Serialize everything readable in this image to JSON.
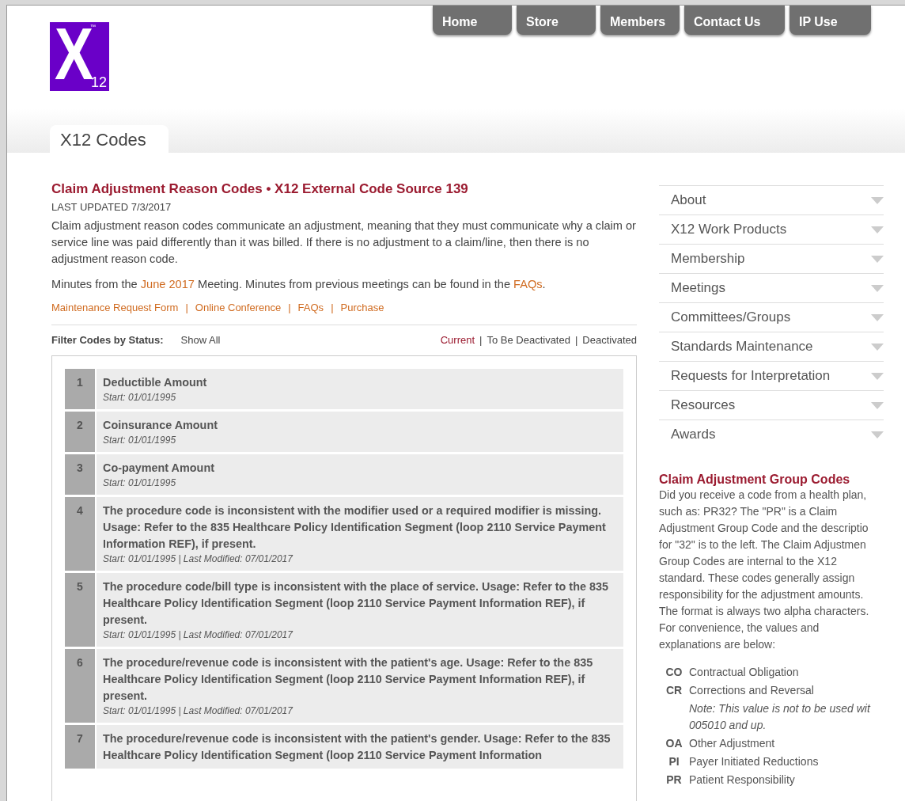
{
  "logo": {
    "mark": "X",
    "number": "12",
    "trademark": "™"
  },
  "nav": [
    {
      "label": "Home"
    },
    {
      "label": "Store"
    },
    {
      "label": "Members"
    },
    {
      "label": "Contact Us"
    },
    {
      "label": "IP Use"
    }
  ],
  "section_tab": "X12 Codes",
  "title": "Claim Adjustment Reason Codes • X12 External Code Source 139",
  "last_updated": "LAST UPDATED 7/3/2017",
  "intro": "Claim adjustment reason codes communicate an adjustment, meaning that they must communicate why a claim or service line was paid differently than it was billed. If there is no adjustment to a claim/line, then there is no adjustment reason code.",
  "minutes": [
    {
      "kind": "text",
      "text": "Minutes from the "
    },
    {
      "kind": "link",
      "text": "June 2017"
    },
    {
      "kind": "text",
      "text": " Meeting. Minutes from previous meetings can be found in the "
    },
    {
      "kind": "link",
      "text": "FAQs"
    },
    {
      "kind": "text",
      "text": "."
    }
  ],
  "links_separator": "|",
  "links": [
    {
      "label": "Maintenance Request Form"
    },
    {
      "label": "Online Conference"
    },
    {
      "label": "FAQs"
    },
    {
      "label": "Purchase"
    }
  ],
  "filter": {
    "label": "Filter Codes by Status:",
    "show_all": "Show All",
    "separator": "|",
    "statuses": [
      {
        "label": "Current",
        "selected": true
      },
      {
        "label": "To Be Deactivated",
        "selected": false
      },
      {
        "label": "Deactivated",
        "selected": false
      }
    ]
  },
  "codes": [
    {
      "number": "1",
      "description": "Deductible Amount",
      "dates": "Start: 01/01/1995"
    },
    {
      "number": "2",
      "description": "Coinsurance Amount",
      "dates": "Start: 01/01/1995"
    },
    {
      "number": "3",
      "description": "Co-payment Amount",
      "dates": "Start: 01/01/1995"
    },
    {
      "number": "4",
      "description": "The procedure code is inconsistent with the modifier used or a required modifier is missing. Usage: Refer to the 835 Healthcare Policy Identification Segment (loop 2110 Service Payment Information REF), if present.",
      "dates": "Start: 01/01/1995 | Last Modified: 07/01/2017"
    },
    {
      "number": "5",
      "description": "The procedure code/bill type is inconsistent with the place of service. Usage: Refer to the 835 Healthcare Policy Identification Segment (loop 2110 Service Payment Information REF), if present.",
      "dates": "Start: 01/01/1995 | Last Modified: 07/01/2017"
    },
    {
      "number": "6",
      "description": "The procedure/revenue code is inconsistent with the patient's age. Usage: Refer to the 835 Healthcare Policy Identification Segment (loop 2110 Service Payment Information REF), if present.",
      "dates": "Start: 01/01/1995 | Last Modified: 07/01/2017"
    },
    {
      "number": "7",
      "description": "The procedure/revenue code is inconsistent with the patient's gender. Usage: Refer to the 835 Healthcare Policy Identification Segment (loop 2110 Service Payment Information"
    }
  ],
  "menu": [
    {
      "label": "About"
    },
    {
      "label": "X12 Work Products"
    },
    {
      "label": "Membership"
    },
    {
      "label": "Meetings"
    },
    {
      "label": "Committees/Groups"
    },
    {
      "label": "Standards Maintenance"
    },
    {
      "label": "Requests for Interpretation"
    },
    {
      "label": "Resources"
    },
    {
      "label": "Awards"
    }
  ],
  "group_codes": {
    "title": "Claim Adjustment Group Codes",
    "text": "Did you receive a code from a health plan,\nsuch as: PR32? The \"PR\" is a Claim\nAdjustment Group Code and the descriptio\nfor \"32\" is to the left. The Claim Adjustmen\nGroup Codes are internal to the X12\nstandard. These codes generally assign\nresponsibility for the adjustment amounts.\nThe format is always two alpha characters.\nFor convenience, the values and\nexplanations are below:",
    "items": [
      {
        "code": "CO",
        "meaning": "Contractual Obligation"
      },
      {
        "code": "CR",
        "meaning": "Corrections and Reversal",
        "note": "Note: This value is not to be used wit\n005010 and up."
      },
      {
        "code": "OA",
        "meaning": "Other Adjustment"
      },
      {
        "code": "PI",
        "meaning": "Payer Initiated Reductions"
      },
      {
        "code": "PR",
        "meaning": "Patient Responsibility"
      }
    ]
  }
}
